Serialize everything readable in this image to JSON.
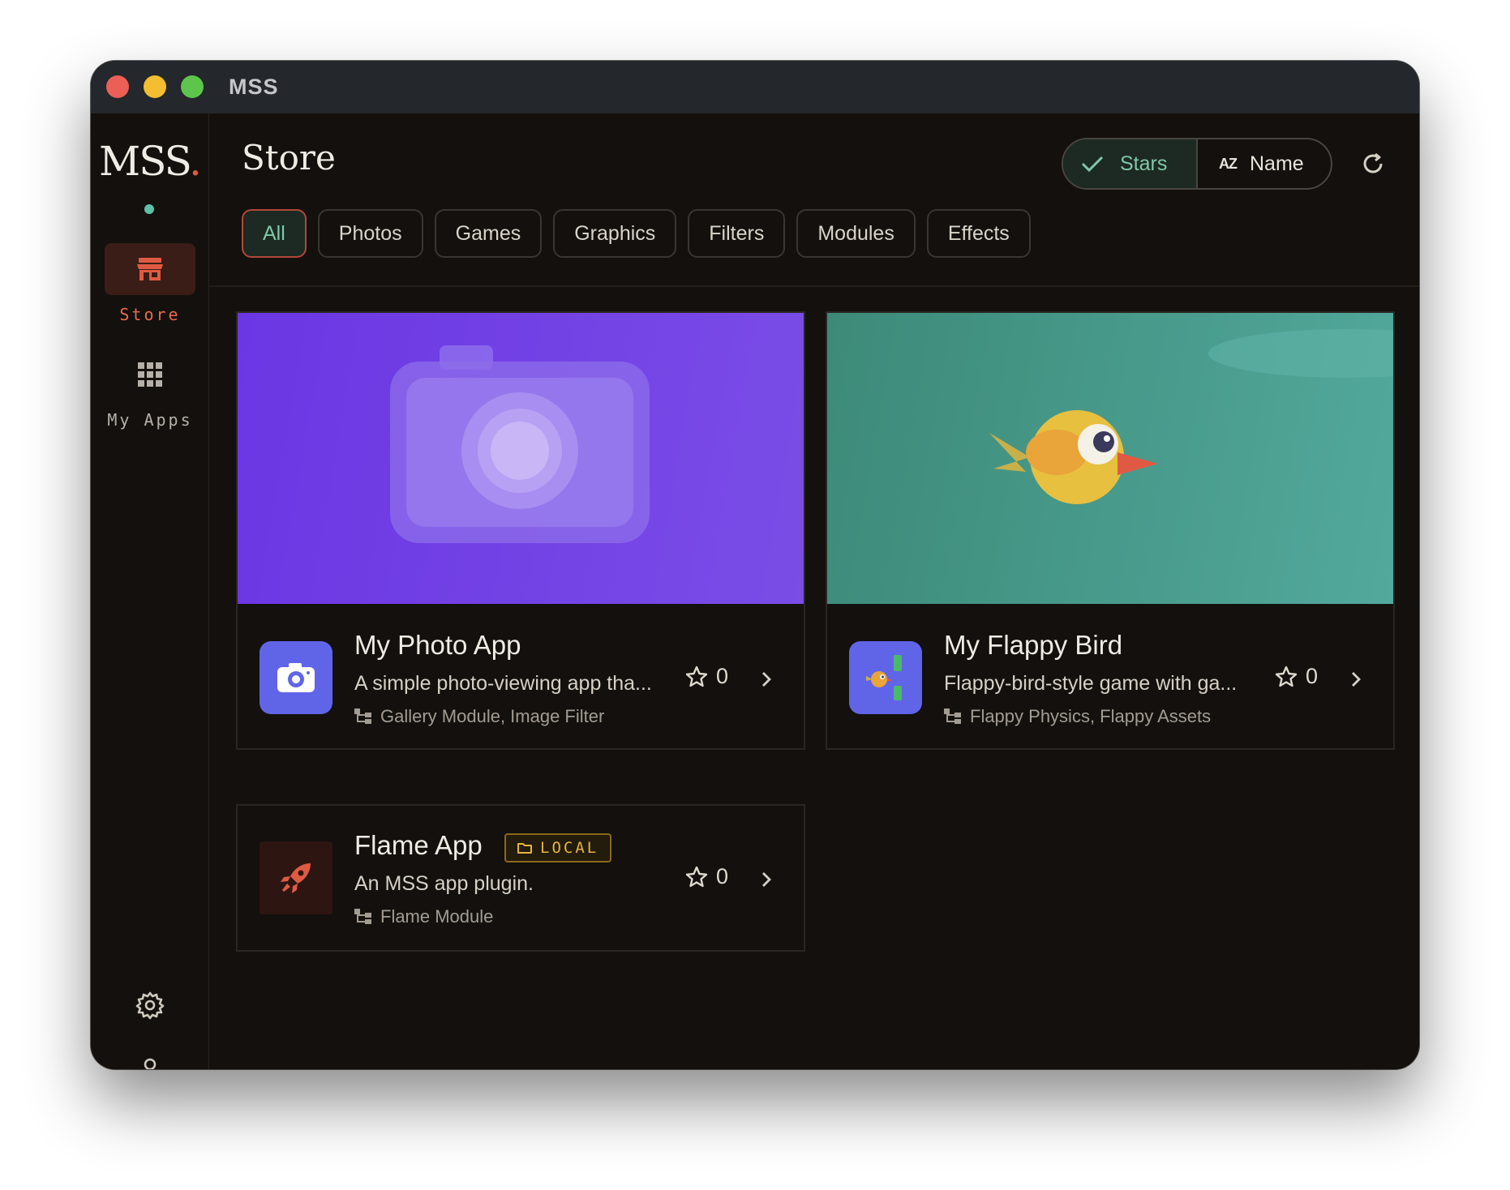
{
  "window": {
    "title": "MSS"
  },
  "sidebar": {
    "logo_text": "MSS",
    "logo_dot": ".",
    "items": [
      {
        "label": "Store",
        "icon": "store-icon",
        "active": true
      },
      {
        "label": "My Apps",
        "icon": "apps-grid-icon",
        "active": false
      }
    ],
    "bottom_icons": [
      "gear-icon",
      "user-icon"
    ]
  },
  "header": {
    "title": "Store",
    "sort": {
      "stars_label": "Stars",
      "name_label": "Name",
      "name_icon_text": "AZ",
      "selected": "Stars"
    }
  },
  "filters": {
    "items": [
      "All",
      "Photos",
      "Games",
      "Graphics",
      "Filters",
      "Modules",
      "Effects"
    ],
    "selected": "All"
  },
  "apps": [
    {
      "name": "My Photo App",
      "description": "A simple photo-viewing app tha...",
      "dependencies": "Gallery Module, Image Filter",
      "stars": "0"
    },
    {
      "name": "My Flappy Bird",
      "description": "Flappy-bird-style game with ga...",
      "dependencies": "Flappy Physics, Flappy Assets",
      "stars": "0"
    },
    {
      "name": "Flame App",
      "badge": "LOCAL",
      "description": "An MSS app plugin.",
      "dependencies": "Flame Module",
      "stars": "0"
    }
  ],
  "colors": {
    "accent_red": "#e05a43",
    "accent_green": "#7fc8a8",
    "local_badge": "#e5b53f",
    "photo_hero": "#6b36e4",
    "bird_hero": "#3d8a78",
    "app_icon_bg": "#6065e8"
  }
}
